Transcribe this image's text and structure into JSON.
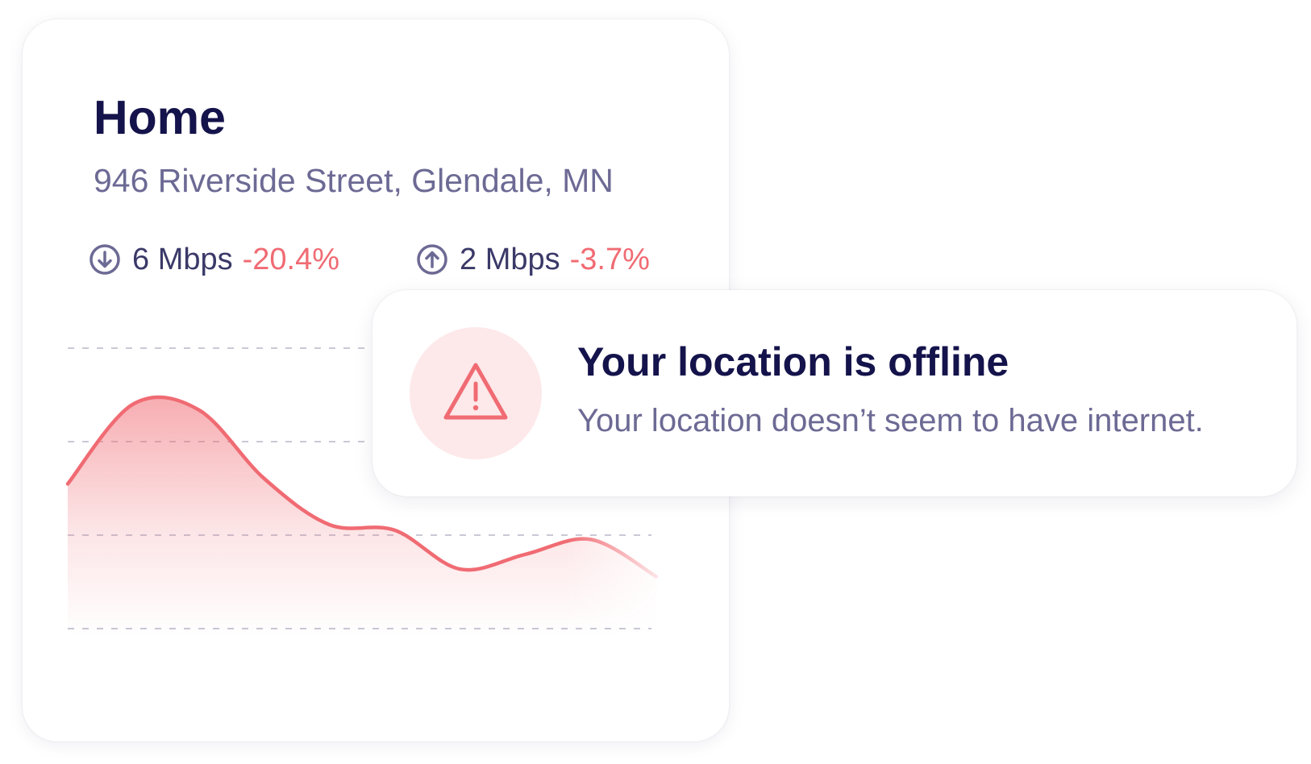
{
  "location_card": {
    "title": "Home",
    "address": "946 Riverside Street, Glendale, MN",
    "download": {
      "icon": "arrow-down-circle-icon",
      "speed": "6 Mbps",
      "change": "-20.4%"
    },
    "upload": {
      "icon": "arrow-up-circle-icon",
      "speed": "2 Mbps",
      "change": "-3.7%"
    }
  },
  "alert": {
    "icon": "warning-triangle-icon",
    "title": "Your location is offline",
    "message": "Your location doesn’t seem to have internet."
  },
  "colors": {
    "heading": "#14134b",
    "secondary_text": "#6c6a94",
    "negative": "#f06b73",
    "alert_badge_bg": "#fde8ea",
    "chart_line": "#f06b73"
  },
  "chart_data": {
    "type": "area",
    "series_color": "#f06b73",
    "grid": true,
    "gridlines": 4,
    "values": [
      0.52,
      0.95,
      0.92,
      0.55,
      0.3,
      0.27,
      0.06,
      0.14,
      0.22,
      0.02
    ]
  }
}
